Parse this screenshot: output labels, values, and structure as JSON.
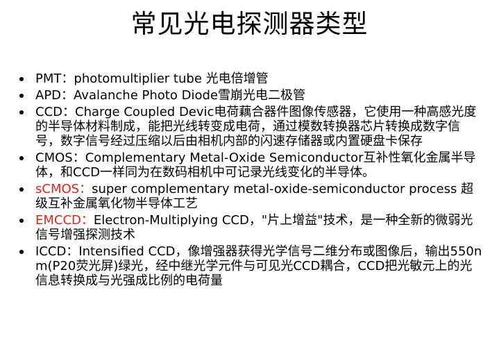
{
  "title": "常见光电探测器类型",
  "items": [
    {
      "label": "PMT：",
      "text": "photomultiplier tube 光电倍增管",
      "label_color": "#000000"
    },
    {
      "label": "APD：",
      "text": "Avalanche Photo Diode雪崩光电二极管",
      "label_color": "#000000"
    },
    {
      "label": "CCD：",
      "text": "Charge Coupled Devic电荷藕合器件图像传感器，它使用一种高感光度的半导体材料制成，能把光线转变成电荷，通过模数转换器芯片转换成数字信号，数字信号经过压缩以后由相机内部的闪速存储器或内置硬盘卡保存",
      "label_color": "#000000"
    },
    {
      "label": "CMOS：",
      "text": "Complementary Metal-Oxide Semiconductor互补性氧化金属半导体，和CCD一样同为在数码相机中可记录光线变化的半导体。",
      "label_color": "#000000"
    },
    {
      "label": "sCMOS：",
      "text": "super complementary metal-oxide-semiconductor process 超级互补金属氧化物半导体工艺",
      "label_color": "#e0241b"
    },
    {
      "label": "EMCCD：",
      "text": "Electron-Multiplying  CCD，\"片上增益\"技术，是一种全新的微弱光信号增强探测技术",
      "label_color": "#e0241b"
    },
    {
      "label": "ICCD：",
      "text": "Intensified CCD，像增强器获得光学信号二维分布或图像后，输出550nm(P20荧光屏)绿光，经中继光学元件与可见光CCD耦合，CCD把光敏元上的光信息转换成与光强成比例的电荷量",
      "label_color": "#000000"
    }
  ]
}
